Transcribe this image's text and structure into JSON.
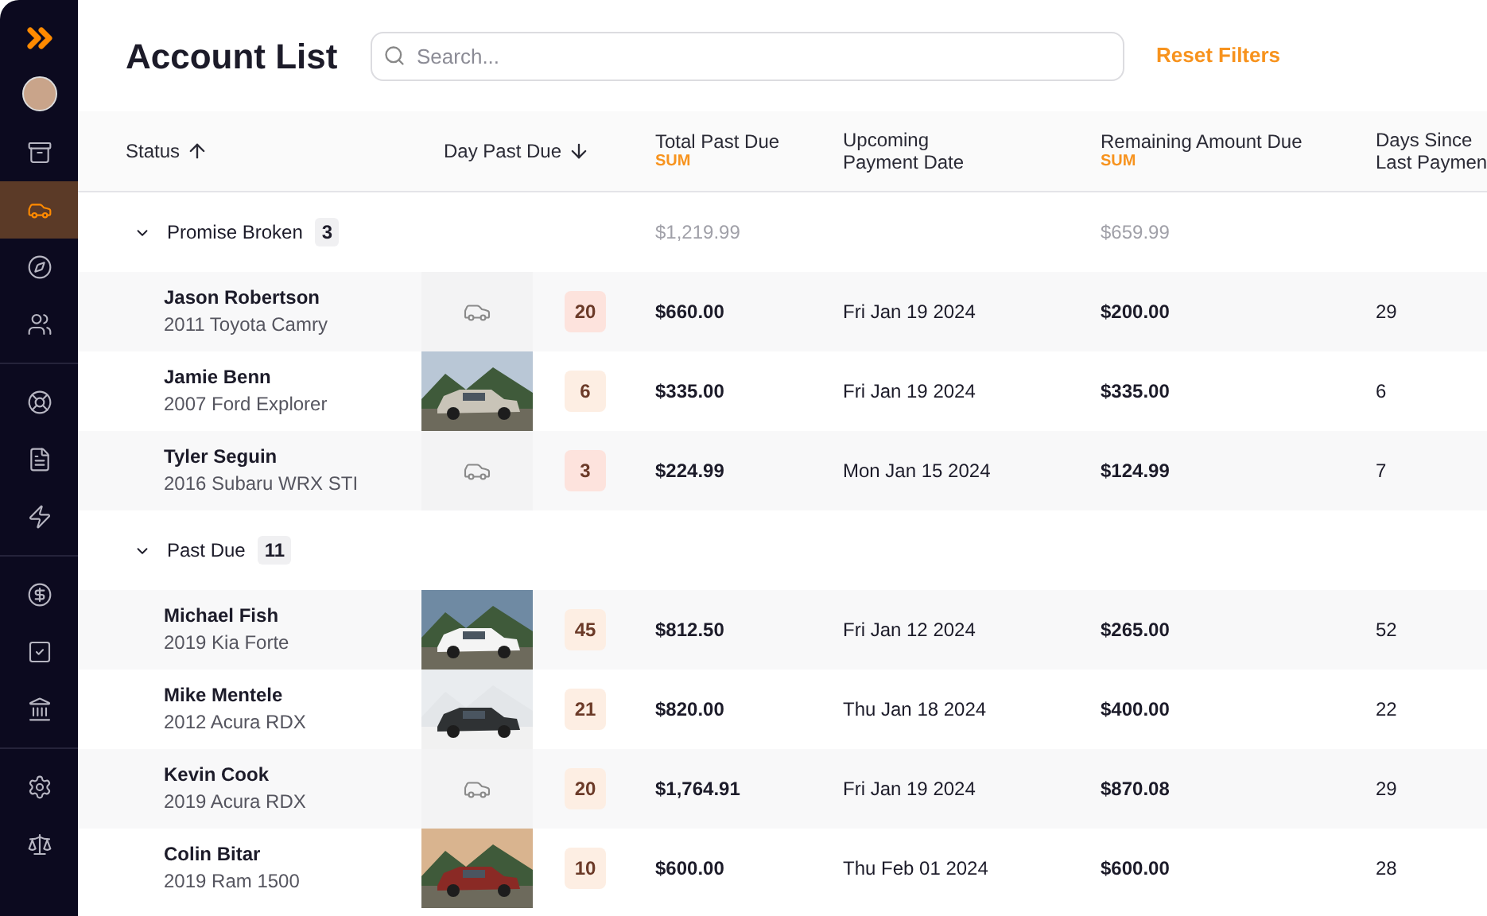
{
  "sidebar": {
    "sections": [
      {
        "items": [
          {
            "selected": false
          },
          {
            "selected": true
          },
          {
            "selected": false
          },
          {
            "selected": false
          }
        ]
      },
      {
        "items": [
          {
            "selected": false
          },
          {
            "selected": false
          },
          {
            "selected": false
          }
        ]
      },
      {
        "items": [
          {
            "selected": false
          },
          {
            "selected": false
          },
          {
            "selected": false
          }
        ]
      },
      {
        "items": [
          {
            "selected": false
          },
          {
            "selected": false
          }
        ]
      }
    ]
  },
  "header": {
    "title": "Account List",
    "search": {
      "placeholder": "Search..."
    },
    "reset_link": "Reset Filters"
  },
  "table": {
    "columns": [
      {
        "label": "Status",
        "sorted": true,
        "ascending": true
      },
      {
        "label": "Day Past Due",
        "sorted": true,
        "ascending": false
      },
      {
        "label": "Total Past Due",
        "sum": "SUM"
      },
      {
        "label": "Upcoming\nPayment Date"
      },
      {
        "label": "Remaining Amount Due",
        "sum": "SUM"
      },
      {
        "label": "Days Since\nLast Paymen"
      }
    ],
    "groups": [
      {
        "label": "Promise Broken",
        "count": "3",
        "expanded": true,
        "total_sum": "$1,219.99",
        "remaining_sum": "$659.99",
        "rows": [
          {
            "name": "Jason Robertson",
            "vehicle": "2011 Toyota Camry",
            "kind": "placeholder",
            "days_past_due": "20",
            "color": "#fde3dd",
            "total": "$660.00",
            "upcoming": "Fri Jan 19 2024",
            "remaining": "$200.00",
            "days_since": "29"
          },
          {
            "name": "Jamie Benn",
            "vehicle": "2007 Ford Explorer",
            "kind": "picture",
            "days_past_due": "6",
            "color": "#fdeee3",
            "total": "$335.00",
            "upcoming": "Fri Jan 19 2024",
            "remaining": "$335.00",
            "days_since": "6"
          },
          {
            "name": "Tyler Seguin",
            "vehicle": "2016 Subaru WRX STI",
            "kind": "placeholder",
            "days_past_due": "3",
            "color": "#fde3dd",
            "total": "$224.99",
            "upcoming": "Mon Jan 15 2024",
            "remaining": "$124.99",
            "days_since": "7"
          }
        ]
      },
      {
        "label": "Past Due",
        "count": "11",
        "expanded": true,
        "rows": [
          {
            "name": "Michael Fish",
            "vehicle": "2019 Kia Forte",
            "kind": "picture",
            "days_past_due": "45",
            "color": "#fdeee3",
            "total": "$812.50",
            "upcoming": "Fri Jan 12 2024",
            "remaining": "$265.00",
            "days_since": "52"
          },
          {
            "name": "Mike Mentele",
            "vehicle": "2012 Acura RDX",
            "kind": "picture",
            "days_past_due": "21",
            "color": "#fdeee3",
            "total": "$820.00",
            "upcoming": "Thu Jan 18 2024",
            "remaining": "$400.00",
            "days_since": "22"
          },
          {
            "name": "Kevin Cook",
            "vehicle": "2019 Acura RDX",
            "kind": "placeholder",
            "days_past_due": "20",
            "color": "#fdeee3",
            "total": "$1,764.91",
            "upcoming": "Fri Jan 19 2024",
            "remaining": "$870.08",
            "days_since": "29"
          },
          {
            "name": "Colin Bitar",
            "vehicle": "2019 Ram 1500",
            "kind": "picture",
            "days_past_due": "10",
            "color": "#fdeee3",
            "total": "$600.00",
            "upcoming": "Thu Feb 01 2024",
            "remaining": "$600.00",
            "days_since": "28"
          }
        ]
      }
    ]
  }
}
